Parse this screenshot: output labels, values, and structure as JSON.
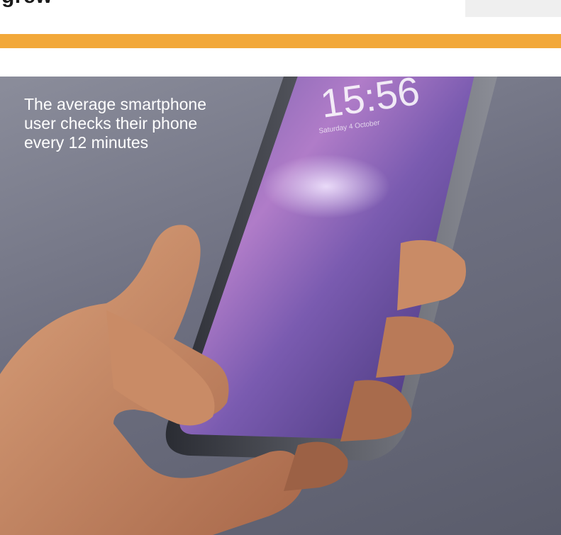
{
  "heading": {
    "fragment": "grew"
  },
  "caption": {
    "text": "The average smartphone user checks their phone every 12 minutes"
  },
  "phone": {
    "time": "15:56",
    "date": "Saturday 4 October"
  },
  "colors": {
    "accent_bar": "#f2a83a",
    "background": "#6d6f80",
    "screen": "#6b4fa8"
  }
}
